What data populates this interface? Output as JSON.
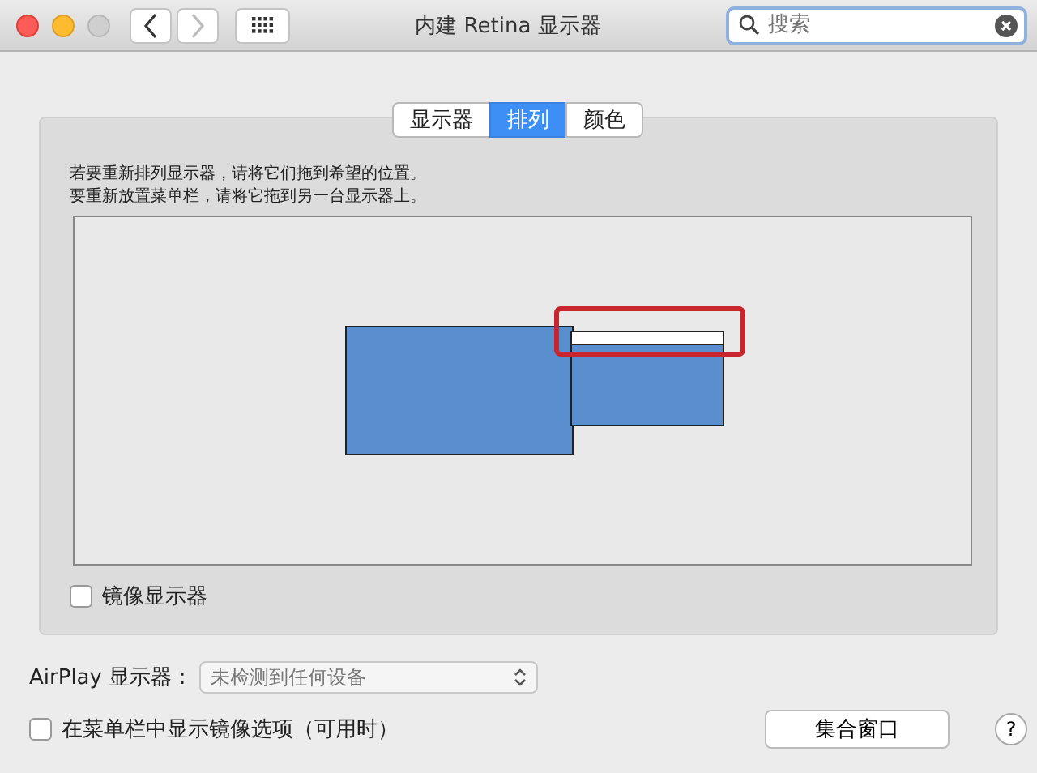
{
  "window": {
    "title": "内建 Retina 显示器"
  },
  "search": {
    "placeholder": "搜索"
  },
  "tabs": [
    {
      "label": "显示器",
      "selected": false
    },
    {
      "label": "排列",
      "selected": true
    },
    {
      "label": "颜色",
      "selected": false
    }
  ],
  "instructions": [
    "若要重新排列显示器，请将它们拖到希望的位置。",
    "要重新放置菜单栏，请将它拖到另一台显示器上。"
  ],
  "displays": [
    {
      "kind": "large",
      "menu_bar": false,
      "highlighted": false
    },
    {
      "kind": "small",
      "menu_bar": true,
      "highlighted": true
    }
  ],
  "mirror": {
    "label": "镜像显示器",
    "checked": false
  },
  "airplay": {
    "label": "AirPlay 显示器：",
    "value": "未检测到任何设备"
  },
  "show_mirroring": {
    "label": "在菜单栏中显示镜像选项（可用时）",
    "checked": false
  },
  "gather_button": "集合窗口",
  "help": "?"
}
